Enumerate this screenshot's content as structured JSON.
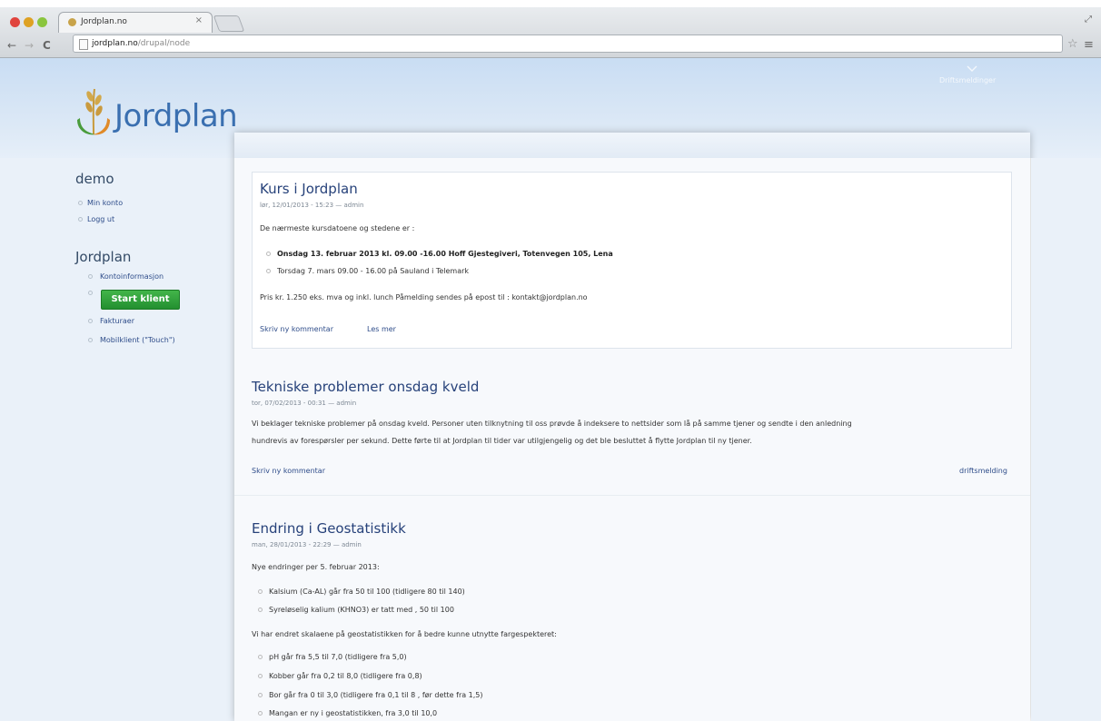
{
  "browser": {
    "tab_title": "Jordplan.no",
    "tab_close": "×",
    "url_host": "jordplan.no",
    "url_path": "/drupal/node",
    "back_glyph": "←",
    "forward_glyph": "→",
    "reload_glyph": "C",
    "star_glyph": "☆",
    "menu_glyph": "≡",
    "resize_glyph": "⤢"
  },
  "site": {
    "logo_text": "Jordplan",
    "drift_link": "Driftsmeldinger"
  },
  "sidebar": {
    "user_heading": "demo",
    "user_links": [
      "Min konto",
      "Logg ut"
    ],
    "section_heading": "Jordplan",
    "links": {
      "kontoinfo": "Kontoinformasjon",
      "start": "Start klient",
      "fakturaer": "Fakturaer",
      "mobil": "Mobilklient (\"Touch\")"
    }
  },
  "nodes": [
    {
      "title": "Kurs i Jordplan",
      "meta": "lør, 12/01/2013 - 15:23 — admin",
      "intro": "De nærmeste kursdatoene og stedene er :",
      "bullets": [
        "Onsdag 13. februar 2013 kl. 09.00 -16.00 Hoff Gjestegiveri, Totenvegen 105, Lena",
        "Torsdag 7. mars 09.00 - 16.00 på Sauland i Telemark"
      ],
      "price": "Pris kr. 1.250 eks. mva og inkl. lunch Påmelding sendes på epost til : kontakt@jordplan.no",
      "links": [
        "Skriv ny kommentar",
        "Les mer"
      ]
    },
    {
      "title": "Tekniske problemer onsdag kveld",
      "meta": "tor, 07/02/2013 - 00:31 — admin",
      "body_line1": "Vi beklager tekniske problemer på onsdag kveld. Personer uten tilknytning til oss prøvde å indeksere to nettsider som lå på samme tjener og sendte i den anledning",
      "body_line2": "hundrevis av forespørsler per sekund. Dette førte til at Jordplan til tider var utilgjengelig og det ble besluttet å flytte Jordplan til ny tjener.",
      "comment": "Skriv ny kommentar",
      "tag": "driftsmelding"
    },
    {
      "title": "Endring i Geostatistikk",
      "meta": "man, 28/01/2013 - 22:29 — admin",
      "intro": "Nye endringer per 5. februar 2013:",
      "bullets1": [
        "Kalsium (Ca-AL) går fra 50 til 100 (tidligere 80 til 140)",
        "Syreløselig kalium (KHNO3) er tatt med , 50 til 100"
      ],
      "mid": "Vi har endret skalaene på geostatistikken for å bedre kunne utnytte fargespekteret:",
      "bullets2": [
        "pH går fra 5,5 til 7,0 (tidligere fra 5,0)",
        "Kobber går fra 0,2 til 8,0 (tidligere fra 0,8)",
        "Bor går fra 0 til 3,0 (tidligere fra 0,1 til 8 , før dette fra 1,5)",
        "Mangan er ny i geostatistikken, fra 3,0 til 10,0"
      ]
    }
  ]
}
